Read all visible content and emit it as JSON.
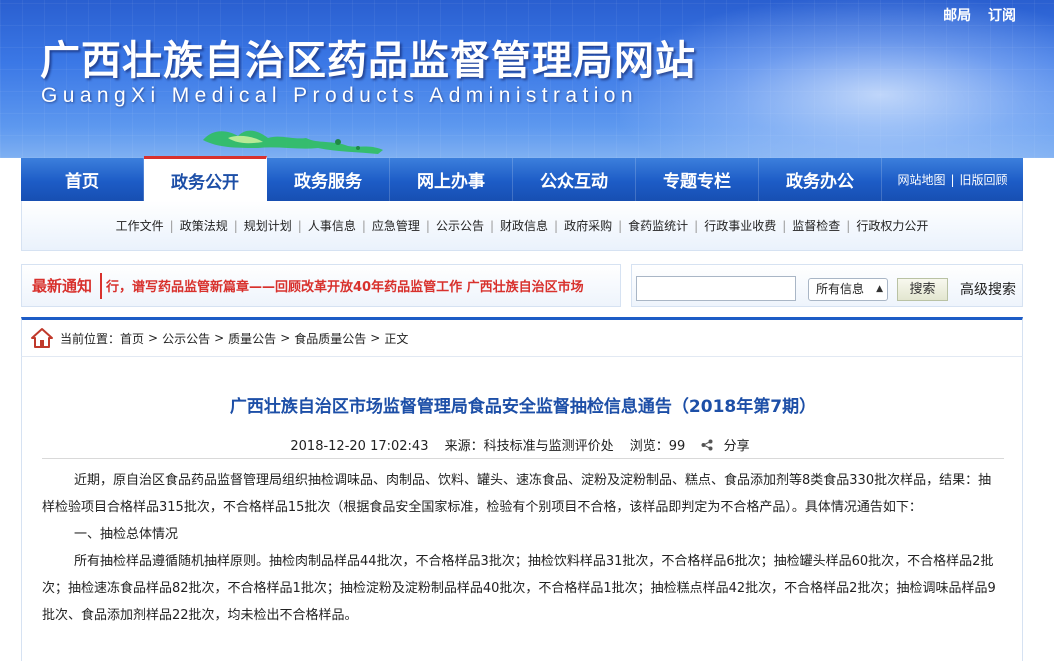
{
  "header": {
    "top_links": [
      "邮局",
      "订阅"
    ],
    "title": "广西壮族自治区药品监督管理局网站",
    "subtitle": "GuangXi Medical Products Administration"
  },
  "nav": {
    "items": [
      {
        "label": "首页",
        "active": false
      },
      {
        "label": "政务公开",
        "active": true
      },
      {
        "label": "政务服务",
        "active": false
      },
      {
        "label": "网上办事",
        "active": false
      },
      {
        "label": "公众互动",
        "active": false
      },
      {
        "label": "专题专栏",
        "active": false
      },
      {
        "label": "政务办公",
        "active": false
      }
    ],
    "tools": [
      "网站地图",
      "旧版回顾"
    ]
  },
  "subnav": [
    "工作文件",
    "政策法规",
    "规划计划",
    "人事信息",
    "应急管理",
    "公示公告",
    "财政信息",
    "政府采购",
    "食药监统计",
    "行政事业收费",
    "监督检查",
    "行政权力公开"
  ],
  "notice": {
    "label": "最新通知",
    "marquee": "行，谱写药品监管新篇章——回顾改革开放40年药品监管工作  广西壮族自治区市场"
  },
  "search": {
    "placeholder": "",
    "select_value": "所有信息",
    "button_label": "搜索",
    "advanced_label": "高级搜索"
  },
  "breadcrumb": {
    "prefix": "当前位置：",
    "items": [
      "首页",
      "公示公告",
      "质量公告",
      "食品质量公告",
      "正文"
    ]
  },
  "article": {
    "title": "广西壮族自治区市场监督管理局食品安全监督抽检信息通告（2018年第7期）",
    "date": "2018-12-20 17:02:43",
    "source": "来源：科技标准与监测评价处",
    "views": "浏览：99",
    "share": "分享",
    "paragraphs": [
      "近期，原自治区食品药品监督管理局组织抽检调味品、肉制品、饮料、罐头、速冻食品、淀粉及淀粉制品、糕点、食品添加剂等8类食品330批次样品，结果：抽样检验项目合格样品315批次，不合格样品15批次（根据食品安全国家标准，检验有个别项目不合格，该样品即判定为不合格产品）。具体情况通告如下：",
      "一、抽检总体情况",
      "所有抽检样品遵循随机抽样原则。抽检肉制品样品44批次，不合格样品3批次；抽检饮料样品31批次，不合格样品6批次；抽检罐头样品60批次，不合格样品2批次；抽检速冻食品样品82批次，不合格样品1批次；抽检淀粉及淀粉制品样品40批次，不合格样品1批次；抽检糕点样品42批次，不合格样品2批次；抽检调味品样品9批次、食品添加剂样品22批次，均未检出不合格样品。"
    ]
  },
  "colors": {
    "nav_blue": "#1d5cc6",
    "accent_red": "#d8312d",
    "title_blue": "#1d4fa7"
  }
}
